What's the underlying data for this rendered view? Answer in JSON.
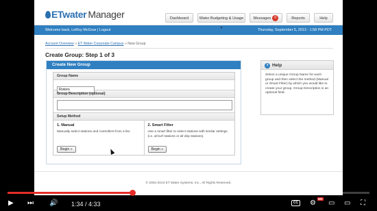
{
  "app": {
    "logo_brand": "ETwater",
    "logo_product": "Manager",
    "nav": [
      {
        "label": "Dashboard"
      },
      {
        "label": "Water Budgeting & Usage ▾"
      },
      {
        "label": "Messages",
        "badge": "0"
      },
      {
        "label": "Reports"
      },
      {
        "label": "Help"
      }
    ],
    "welcome": "Welcome back, LeRoy McGrue | Logout",
    "datetime": "Thursday, September 5, 2013 - 1:58 PM PDT"
  },
  "breadcrumb": {
    "items": [
      "Account Overview",
      "ET Water Corporate Campus"
    ],
    "separator": "»",
    "current": "New Group"
  },
  "page": {
    "title": "Create Group: Step 1 of 3",
    "panel_title": "Create New Group",
    "group_name_label": "Group Name",
    "group_name_value": "Rotors",
    "description_label": "Group Description (optional)",
    "description_value": "",
    "setup_label": "Setup Method",
    "manual": {
      "title": "1. Manual",
      "desc": "Manually select stations and controllers from a list.",
      "button": "Begin »"
    },
    "smart": {
      "title": "2. Smart Filter",
      "desc": "Use a smart filter to select stations with similar settings (i.e. all turf stations or all drip stations).",
      "button": "Begin »"
    }
  },
  "help": {
    "title": "Help",
    "body": "Select a unique Group Name for each group and then select the method (Manual or Smart Filter) by which you would like to create your group. Group Description is an optional field."
  },
  "footer": "© 2003-2013 ET Water Systems, Inc., All Rights Reserved.",
  "player": {
    "time": "1:34 / 4:33",
    "progress_fraction": 0.344,
    "hd_badge": "HD",
    "cc_label": "CC",
    "accent_color": "#e52d27"
  }
}
